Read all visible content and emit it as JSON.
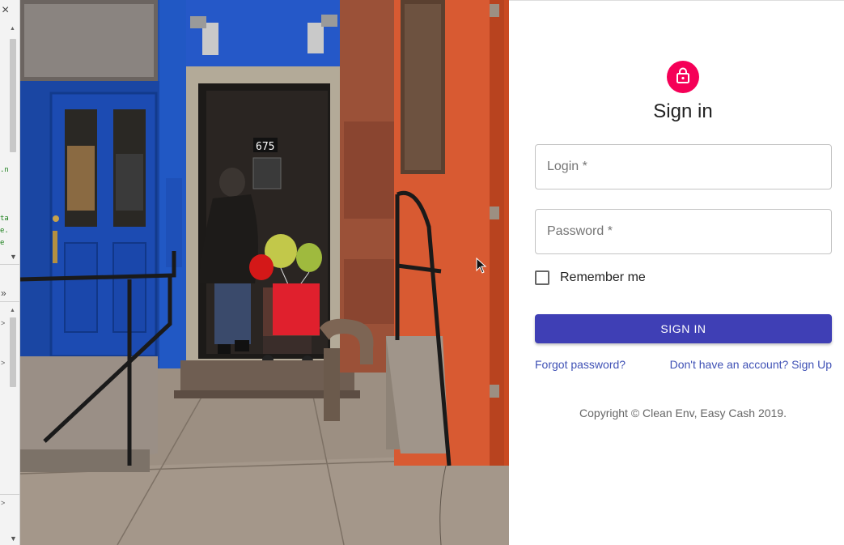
{
  "devtools": {
    "close_label": "×",
    "code_lines": [
      ".n",
      "ta",
      "e.",
      "e"
    ],
    "collapse_label": "»",
    "arrow_labels": [
      ">",
      ">",
      ">"
    ]
  },
  "photo": {
    "door_number": "675",
    "description_icon": "street-doorway-photo"
  },
  "form": {
    "avatar_icon": "lock-icon",
    "accent_color": "#f50057",
    "primary_color": "#3f3fb5",
    "title": "Sign in",
    "login_label": "Login *",
    "password_label": "Password *",
    "remember_label": "Remember me",
    "submit_label": "SIGN IN",
    "forgot_link": "Forgot password?",
    "signup_link": "Don't have an account? Sign Up",
    "copyright": "Copyright © Clean Env, Easy Cash 2019."
  }
}
